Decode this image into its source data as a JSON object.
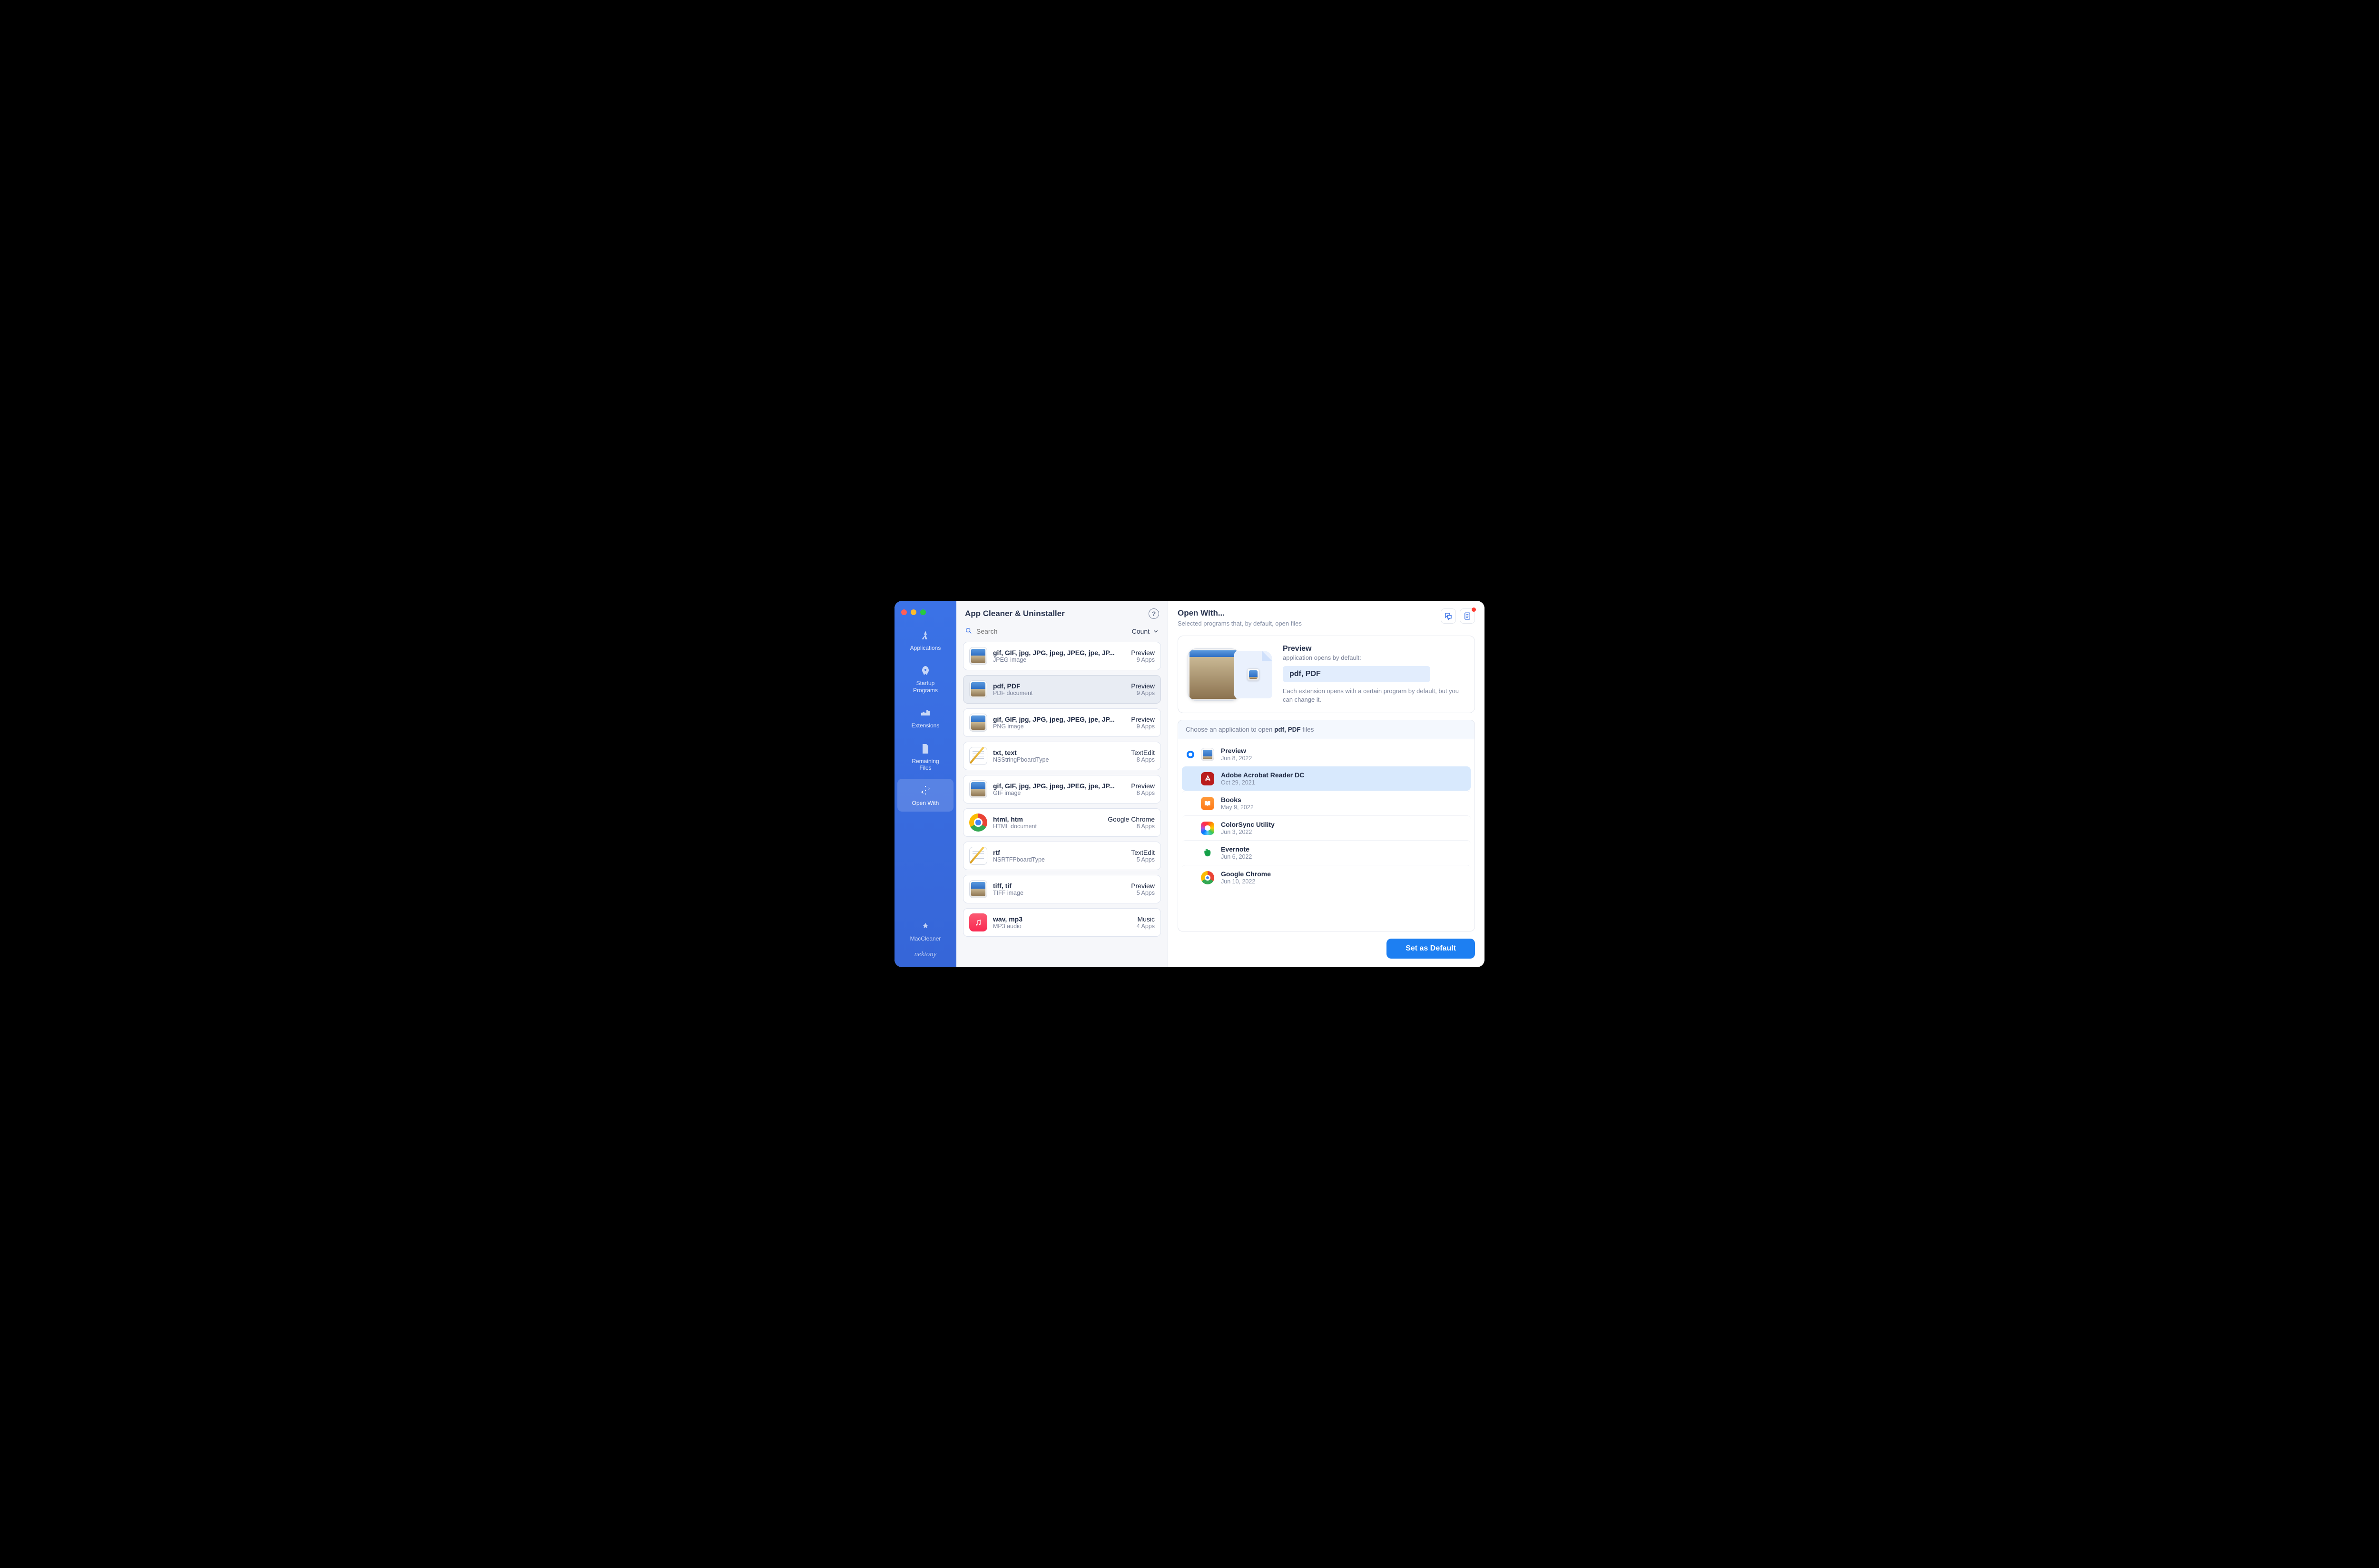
{
  "window_title": "App Cleaner & Uninstaller",
  "search": {
    "placeholder": "Search"
  },
  "sort": {
    "label": "Count"
  },
  "sidebar": {
    "items": [
      {
        "label": "Applications",
        "active": false
      },
      {
        "label": "Startup\nPrograms",
        "active": false
      },
      {
        "label": "Extensions",
        "active": false
      },
      {
        "label": "Remaining\nFiles",
        "active": false
      },
      {
        "label": "Open With",
        "active": true
      }
    ],
    "maccleaner": "MacCleaner",
    "brand": "nektony"
  },
  "extensions": [
    {
      "title": "gif, GIF, jpg, JPG, jpeg, JPEG, jpe, JP...",
      "sub": "JPEG image",
      "app": "Preview",
      "count": "9 Apps",
      "icon": "preview"
    },
    {
      "title": "pdf, PDF",
      "sub": "PDF document",
      "app": "Preview",
      "count": "9 Apps",
      "icon": "preview",
      "selected": true
    },
    {
      "title": "gif, GIF, jpg, JPG, jpeg, JPEG, jpe, JP...",
      "sub": "PNG image",
      "app": "Preview",
      "count": "9 Apps",
      "icon": "preview"
    },
    {
      "title": "txt, text",
      "sub": "NSStringPboardType",
      "app": "TextEdit",
      "count": "8 Apps",
      "icon": "textedit"
    },
    {
      "title": "gif, GIF, jpg, JPG, jpeg, JPEG, jpe, JP...",
      "sub": "GIF image",
      "app": "Preview",
      "count": "8 Apps",
      "icon": "preview"
    },
    {
      "title": "html, htm",
      "sub": "HTML document",
      "app": "Google Chrome",
      "count": "8 Apps",
      "icon": "chrome"
    },
    {
      "title": "rtf",
      "sub": "NSRTFPboardType",
      "app": "TextEdit",
      "count": "5 Apps",
      "icon": "textedit"
    },
    {
      "title": "tiff, tif",
      "sub": "TIFF image",
      "app": "Preview",
      "count": "5 Apps",
      "icon": "preview"
    },
    {
      "title": "wav, mp3",
      "sub": "MP3 audio",
      "app": "Music",
      "count": "4 Apps",
      "icon": "music"
    }
  ],
  "detail": {
    "title": "Open With...",
    "subtitle": "Selected programs that, by default, open files",
    "info": {
      "app": "Preview",
      "opens": "application opens by default:",
      "extensions": "pdf, PDF",
      "note": "Each extension opens with a certain program by default, but you can change it."
    },
    "choose_prefix": "Choose an application to open ",
    "choose_ext": "pdf, PDF",
    "choose_suffix": " files",
    "apps": [
      {
        "name": "Preview",
        "date": "Jun 8, 2022",
        "selected": true,
        "icon": "preview"
      },
      {
        "name": "Adobe Acrobat Reader DC",
        "date": "Oct 29, 2021",
        "highlight": true,
        "icon": "acrobat"
      },
      {
        "name": "Books",
        "date": "May 9, 2022",
        "icon": "books"
      },
      {
        "name": "ColorSync Utility",
        "date": "Jun 3, 2022",
        "icon": "colorsync"
      },
      {
        "name": "Evernote",
        "date": "Jun 6, 2022",
        "icon": "evernote"
      },
      {
        "name": "Google Chrome",
        "date": "Jun 10, 2022",
        "icon": "chrome"
      }
    ],
    "button": "Set as Default"
  }
}
